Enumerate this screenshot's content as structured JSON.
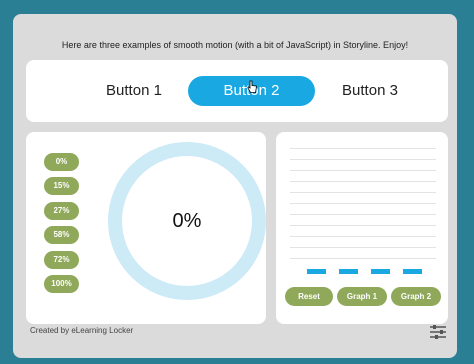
{
  "intro_text": "Here are three examples of smooth motion (with a bit of JavaScript) in Storyline. Enjoy!",
  "tabs": [
    {
      "label": "Button 1"
    },
    {
      "label": "Button 2",
      "selected": true
    },
    {
      "label": "Button 3"
    }
  ],
  "percent_buttons": [
    "0%",
    "15%",
    "27%",
    "58%",
    "72%",
    "100%"
  ],
  "progress_ring": {
    "label": "0%",
    "value": 0
  },
  "graph": {
    "bars": 4,
    "buttons": {
      "reset": "Reset",
      "graph1": "Graph 1",
      "graph2": "Graph 2"
    }
  },
  "footer": "Created by eLearning Locker",
  "icons": {
    "settings": "sliders-icon",
    "cursor": "hand-pointer-icon"
  },
  "colors": {
    "accent": "#1aa8e2",
    "button_green": "#8fa85a",
    "ring_track": "#cdeaf7",
    "frame": "#2a7f95",
    "stage_bg": "#dbdbdb"
  }
}
